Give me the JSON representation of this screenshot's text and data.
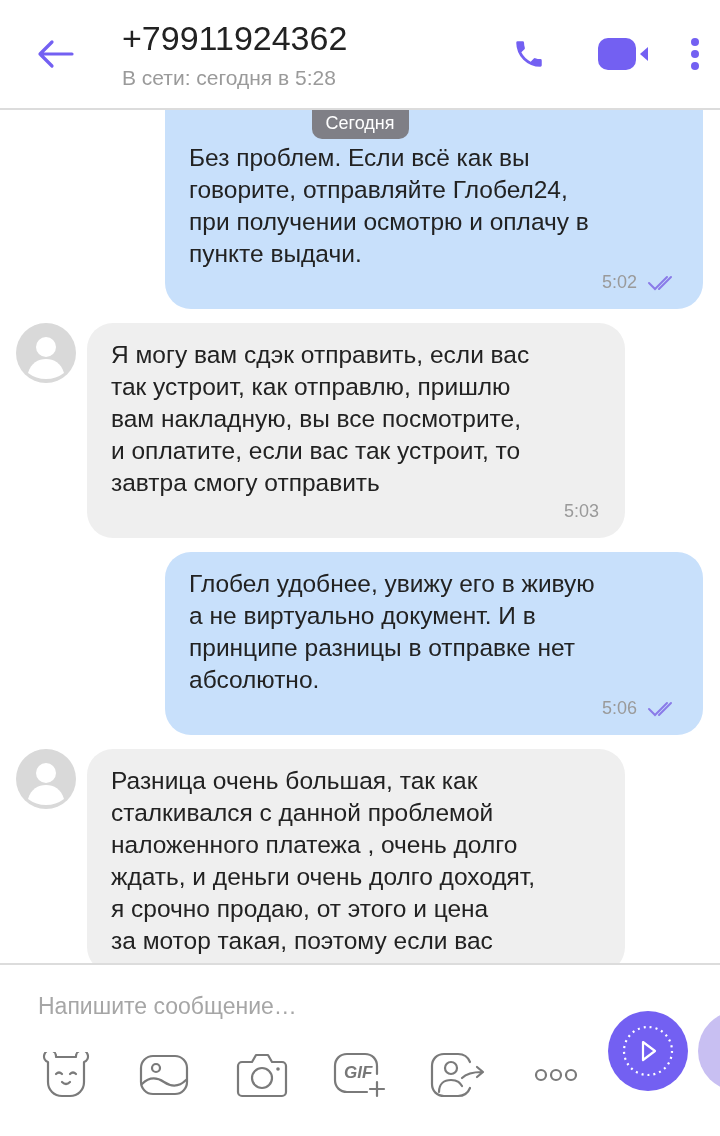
{
  "header": {
    "title": "+79911924362",
    "status": "В сети: сегодня в 5:28"
  },
  "date_badge": "Сегодня",
  "messages": [
    {
      "kind": "out",
      "text": "Без проблем. Если всё как вы\nговорите, отправляйте Глобел24,\nпри получении осмотрю и оплачу в\nпункте выдачи.",
      "time": "5:02",
      "read": true
    },
    {
      "kind": "in",
      "text": "Я могу вам сдэк отправить, если вас\nтак устроит, как отправлю, пришлю\nвам накладную, вы все посмотрите,\nи оплатите, если вас так устроит, то\nзавтра смогу отправить",
      "time": "5:03"
    },
    {
      "kind": "out",
      "text": "Глобел удобнее, увижу его в живую\nа не виртуально документ. И в\nпринципе разницы в отправке нет\nабсолютно.",
      "time": "5:06",
      "read": true
    },
    {
      "kind": "in",
      "text": "Разница очень большая, так как\nсталкивался с данной проблемой\nналоженного платежа , очень долго\nждать, и деньги очень долго доходят,\nя срочно продаю, от этого и цена\nза мотор такая, поэтому если вас"
    }
  ],
  "composer": {
    "placeholder": "Напишите сообщение…"
  },
  "toolbar": [
    {
      "kind": "sticker"
    },
    {
      "kind": "gallery"
    },
    {
      "kind": "camera"
    },
    {
      "kind": "gif",
      "label": "GIF"
    },
    {
      "kind": "contact"
    },
    {
      "kind": "more"
    }
  ]
}
